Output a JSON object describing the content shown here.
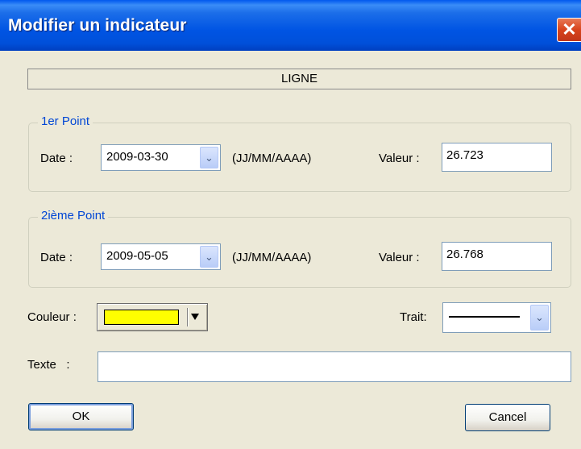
{
  "window": {
    "title": "Modifier un indicateur",
    "close_glyph": "✕"
  },
  "header_bar": {
    "label": "LIGNE"
  },
  "point1": {
    "legend": "1er Point",
    "date_label": "Date :",
    "date_value": "2009-03-30",
    "date_format": "(JJ/MM/AAAA)",
    "valeur_label": "Valeur :",
    "valeur_value": "26.723"
  },
  "point2": {
    "legend": "2ième Point",
    "date_label": "Date :",
    "date_value": "2009-05-05",
    "date_format": "(JJ/MM/AAAA)",
    "valeur_label": "Valeur :",
    "valeur_value": "26.768"
  },
  "couleur": {
    "label": "Couleur :",
    "value_color": "#ffff00"
  },
  "trait": {
    "label": "Trait:",
    "value": "solid-line"
  },
  "texte": {
    "label": "Texte   :",
    "value": ""
  },
  "buttons": {
    "ok": "OK",
    "cancel": "Cancel"
  },
  "icons": {
    "dropdown": "▼",
    "dropdown_combo": "⌄"
  }
}
